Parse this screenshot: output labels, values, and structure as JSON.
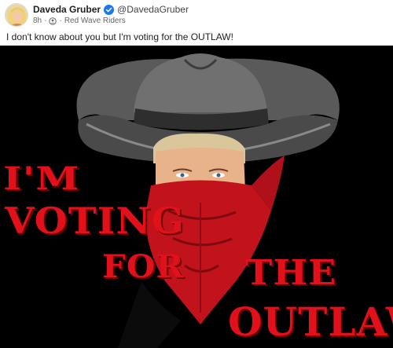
{
  "post": {
    "author_name": "Daveda Gruber",
    "handle": "@DavedaGruber",
    "time": "8h",
    "separator": "·",
    "group": "Red Wave Riders",
    "text": "I don't know about you but I'm voting for the OUTLAW!"
  },
  "image": {
    "lines": [
      "I'M",
      "VOTING",
      "FOR",
      "THE",
      "OUTLAW"
    ]
  },
  "icons": {
    "verified": "verified-badge-icon",
    "audience": "group-audience-icon"
  },
  "colors": {
    "verified_blue": "#1877f2",
    "image_text_red": "#e0111a",
    "image_background": "#000000",
    "bandana_red": "#c2121b"
  }
}
